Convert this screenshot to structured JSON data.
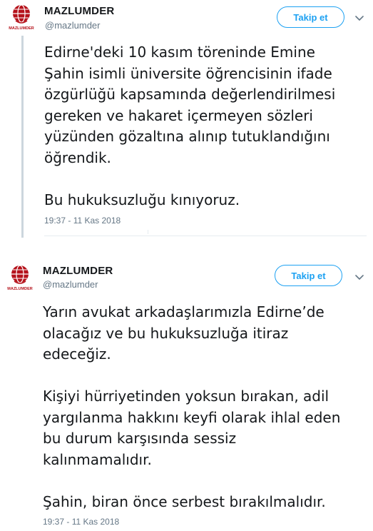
{
  "tweets": [
    {
      "author": {
        "display_name": "MAZLUMDER",
        "handle": "@mazlumder",
        "logo_text": "MAZLUMDER",
        "logo_color": "#b5121b"
      },
      "follow_label": "Takip et",
      "text": "Edirne'deki 10 kasım töreninde Emine\nŞahin isimli üniversite öğrencisinin ifade\nözgürlüğü kapsamında değerlendirilmesi\ngereken ve hakaret içermeyen sözleri\nyüzünden gözaltına alınıp tutuklandığını\nöğrendik.\n\nBu hukuksuzluğu kınıyoruz.",
      "timestamp": "19:37 - 11 Kas 2018"
    },
    {
      "author": {
        "display_name": "MAZLUMDER",
        "handle": "@mazlumder",
        "logo_text": "MAZLUMDER",
        "logo_color": "#b5121b"
      },
      "follow_label": "Takip et",
      "text": "Yarın avukat arkadaşlarımızla Edirne’de\nolacağız ve bu hukuksuzluğa itiraz\nedeceğiz.\n\nKişiyi hürriyetinden yoksun bırakan, adil\nyargılanma hakkını keyfi olarak ihlal eden\nbu durum karşısında sessiz\nkalınmamalıdır.\n\nŞahin, biran önce serbest bırakılmalıdır.",
      "timestamp": "19:37 - 11 Kas 2018"
    }
  ],
  "colors": {
    "accent": "#1da1f2",
    "secondary_text": "#657786",
    "thread_line": "#ccd6dd"
  },
  "icons": {
    "more_menu": "chevron-down-icon",
    "logo": "mazlumder-globe-logo"
  }
}
